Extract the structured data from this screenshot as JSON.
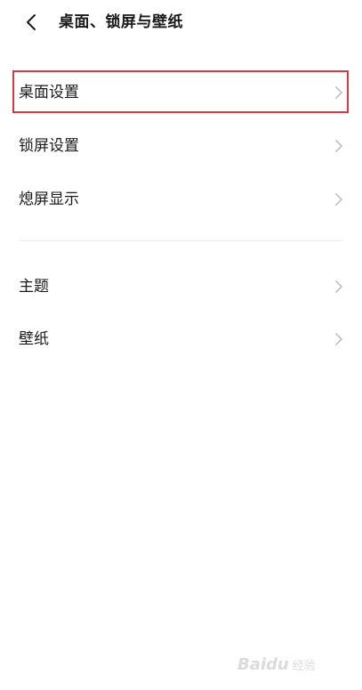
{
  "header": {
    "title": "桌面、锁屏与壁纸",
    "back_icon": "chevron-left-icon"
  },
  "menu_group_1": [
    {
      "label": "桌面设置",
      "icon": "chevron-right-icon",
      "highlighted": true
    },
    {
      "label": "锁屏设置",
      "icon": "chevron-right-icon"
    },
    {
      "label": "熄屏显示",
      "icon": "chevron-right-icon"
    }
  ],
  "menu_group_2": [
    {
      "label": "主题",
      "icon": "chevron-right-icon"
    },
    {
      "label": "壁纸",
      "icon": "chevron-right-icon"
    }
  ],
  "colors": {
    "highlight_border": "#d9383f",
    "text": "#1a1a1a",
    "chevron": "#b8b8b8"
  },
  "watermark": {
    "text": "Baidu",
    "text2": "经验"
  }
}
